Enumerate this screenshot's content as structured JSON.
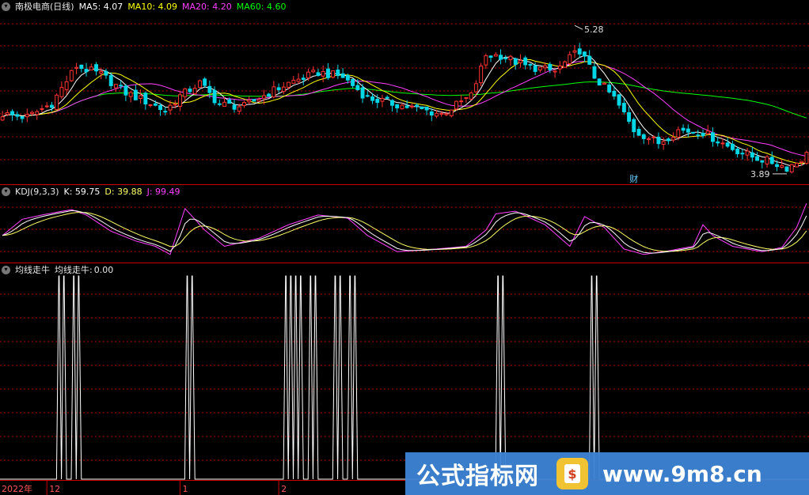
{
  "title": "南极电商(日线)",
  "colors": {
    "ma5": "#ffffff",
    "ma10": "#ffff00",
    "ma20": "#ff40ff",
    "ma60": "#00ff00",
    "up": "#ff3333",
    "down": "#00d7e6",
    "k": "#ffffff",
    "d": "#ffff66",
    "j": "#ff40ff",
    "signal": "#ffffff",
    "grid": "#b40000",
    "panel": "#cc0000"
  },
  "ma_legend": [
    {
      "label": "MA5:",
      "value": "4.07",
      "color_key": "ma5"
    },
    {
      "label": "MA10:",
      "value": "4.09",
      "color_key": "ma10"
    },
    {
      "label": "MA20:",
      "value": "4.20",
      "color_key": "ma20"
    },
    {
      "label": "MA60:",
      "value": "4.60",
      "color_key": "ma60"
    }
  ],
  "kdj_legend": {
    "name": "KDJ(9,3,3)",
    "items": [
      {
        "label": "K:",
        "value": "59.75",
        "color_key": "k"
      },
      {
        "label": "D:",
        "value": "39.88",
        "color_key": "d"
      },
      {
        "label": "J:",
        "value": "99.49",
        "color_key": "j"
      }
    ]
  },
  "signal_legend": {
    "name": "均线走牛",
    "label": "均线走牛:",
    "value": "0.00"
  },
  "annotations": {
    "high": "5.28",
    "low": "3.89",
    "event": "财"
  },
  "x_axis": {
    "labels": [
      "2022年",
      "12",
      "1",
      "2"
    ]
  },
  "watermark": {
    "left": "公式指标网",
    "right": "www.9m8.cn"
  },
  "chart_data": [
    {
      "type": "candlestick",
      "title": "南极电商(日线)",
      "price_range": [
        3.8,
        5.4
      ],
      "high_marker": 5.28,
      "low_marker": 3.89,
      "close_anchors": [
        [
          0,
          4.45
        ],
        [
          5,
          4.42
        ],
        [
          10,
          4.55
        ],
        [
          15,
          4.9
        ],
        [
          20,
          4.82
        ],
        [
          25,
          4.65
        ],
        [
          30,
          4.55
        ],
        [
          33,
          4.48
        ],
        [
          36,
          4.62
        ],
        [
          40,
          4.74
        ],
        [
          44,
          4.54
        ],
        [
          49,
          4.52
        ],
        [
          54,
          4.65
        ],
        [
          59,
          4.76
        ],
        [
          64,
          4.84
        ],
        [
          69,
          4.8
        ],
        [
          74,
          4.6
        ],
        [
          79,
          4.55
        ],
        [
          84,
          4.5
        ],
        [
          89,
          4.45
        ],
        [
          95,
          4.62
        ],
        [
          98,
          5.0
        ],
        [
          101,
          5.0
        ],
        [
          106,
          4.9
        ],
        [
          112,
          4.85
        ],
        [
          117,
          5.05
        ],
        [
          120,
          4.8
        ],
        [
          124,
          4.6
        ],
        [
          128,
          4.3
        ],
        [
          133,
          4.18
        ],
        [
          137,
          4.3
        ],
        [
          142,
          4.28
        ],
        [
          147,
          4.15
        ],
        [
          152,
          4.05
        ],
        [
          156,
          4.0
        ],
        [
          159,
          3.95
        ],
        [
          161,
          4.0
        ],
        [
          163,
          4.07
        ]
      ],
      "series": [
        {
          "name": "MA5",
          "value": 4.07
        },
        {
          "name": "MA10",
          "value": 4.09
        },
        {
          "name": "MA20",
          "value": 4.2
        },
        {
          "name": "MA60",
          "value": 4.6
        }
      ]
    },
    {
      "type": "line",
      "title": "KDJ(9,3,3)",
      "ylim": [
        -10,
        110
      ],
      "j_anchors": [
        [
          0,
          40
        ],
        [
          4,
          70
        ],
        [
          8,
          78
        ],
        [
          14,
          88
        ],
        [
          17,
          78
        ],
        [
          22,
          48
        ],
        [
          27,
          30
        ],
        [
          31,
          20
        ],
        [
          34,
          5
        ],
        [
          37,
          90
        ],
        [
          41,
          50
        ],
        [
          45,
          20
        ],
        [
          52,
          35
        ],
        [
          58,
          60
        ],
        [
          64,
          78
        ],
        [
          70,
          72
        ],
        [
          74,
          40
        ],
        [
          80,
          10
        ],
        [
          88,
          15
        ],
        [
          94,
          20
        ],
        [
          98,
          50
        ],
        [
          100,
          80
        ],
        [
          104,
          85
        ],
        [
          110,
          60
        ],
        [
          115,
          20
        ],
        [
          118,
          75
        ],
        [
          122,
          55
        ],
        [
          126,
          15
        ],
        [
          130,
          5
        ],
        [
          134,
          10
        ],
        [
          140,
          20
        ],
        [
          142,
          60
        ],
        [
          144,
          40
        ],
        [
          148,
          20
        ],
        [
          154,
          10
        ],
        [
          158,
          18
        ],
        [
          161,
          55
        ],
        [
          163,
          99.49
        ]
      ],
      "series": [
        {
          "name": "K",
          "value": 59.75
        },
        {
          "name": "D",
          "value": 39.88
        },
        {
          "name": "J",
          "value": 99.49
        }
      ]
    },
    {
      "type": "line",
      "title": "均线走牛",
      "ylim": [
        0,
        1
      ],
      "series": [
        {
          "name": "均线走牛",
          "value": 0.0
        }
      ],
      "pulses": [
        [
          11,
          12
        ],
        [
          14,
          15
        ],
        [
          37,
          38
        ],
        [
          57,
          60
        ],
        [
          62,
          63
        ],
        [
          67,
          68
        ],
        [
          70,
          71
        ],
        [
          100,
          101
        ],
        [
          119,
          120
        ]
      ]
    }
  ]
}
